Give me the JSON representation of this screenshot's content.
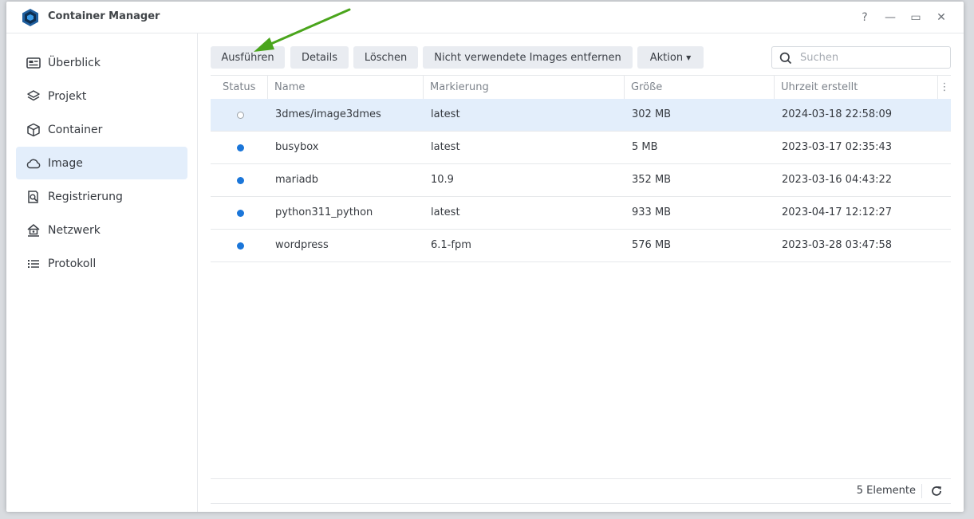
{
  "window": {
    "title": "Container Manager",
    "controls": [
      "?",
      "—",
      "▭",
      "✕"
    ]
  },
  "sidebar": {
    "items": [
      {
        "label": "Überblick",
        "icon": "overview-icon"
      },
      {
        "label": "Projekt",
        "icon": "layers-icon"
      },
      {
        "label": "Container",
        "icon": "cube-icon"
      },
      {
        "label": "Image",
        "icon": "cloud-icon",
        "active": true
      },
      {
        "label": "Registrierung",
        "icon": "registry-search-icon"
      },
      {
        "label": "Netzwerk",
        "icon": "network-icon"
      },
      {
        "label": "Protokoll",
        "icon": "list-icon"
      }
    ]
  },
  "toolbar": {
    "run_label": "Ausführen",
    "details_label": "Details",
    "delete_label": "Löschen",
    "remove_unused_label": "Nicht verwendete Images entfernen",
    "action_label": "Aktion"
  },
  "search": {
    "placeholder": "Suchen",
    "value": ""
  },
  "table": {
    "columns": [
      "Status",
      "Name",
      "Markierung",
      "Größe",
      "Uhrzeit erstellt"
    ],
    "rows": [
      {
        "status": "unused",
        "name": "3dmes/image3dmes",
        "tag": "latest",
        "size": "302 MB",
        "created": "2024-03-18 22:58:09",
        "selected": true
      },
      {
        "status": "in-use",
        "name": "busybox",
        "tag": "latest",
        "size": "5 MB",
        "created": "2023-03-17 02:35:43"
      },
      {
        "status": "in-use",
        "name": "mariadb",
        "tag": "10.9",
        "size": "352 MB",
        "created": "2023-03-16 04:43:22"
      },
      {
        "status": "in-use",
        "name": "python311_python",
        "tag": "latest",
        "size": "933 MB",
        "created": "2023-04-17 12:12:27"
      },
      {
        "status": "in-use",
        "name": "wordpress",
        "tag": "6.1-fpm",
        "size": "576 MB",
        "created": "2023-03-28 03:47:58"
      }
    ]
  },
  "footer": {
    "count_label": "5 Elemente"
  },
  "colors": {
    "accent": "#1b76d9",
    "selected_row": "#e3eefb",
    "annotation_arrow": "#4aa51c"
  }
}
